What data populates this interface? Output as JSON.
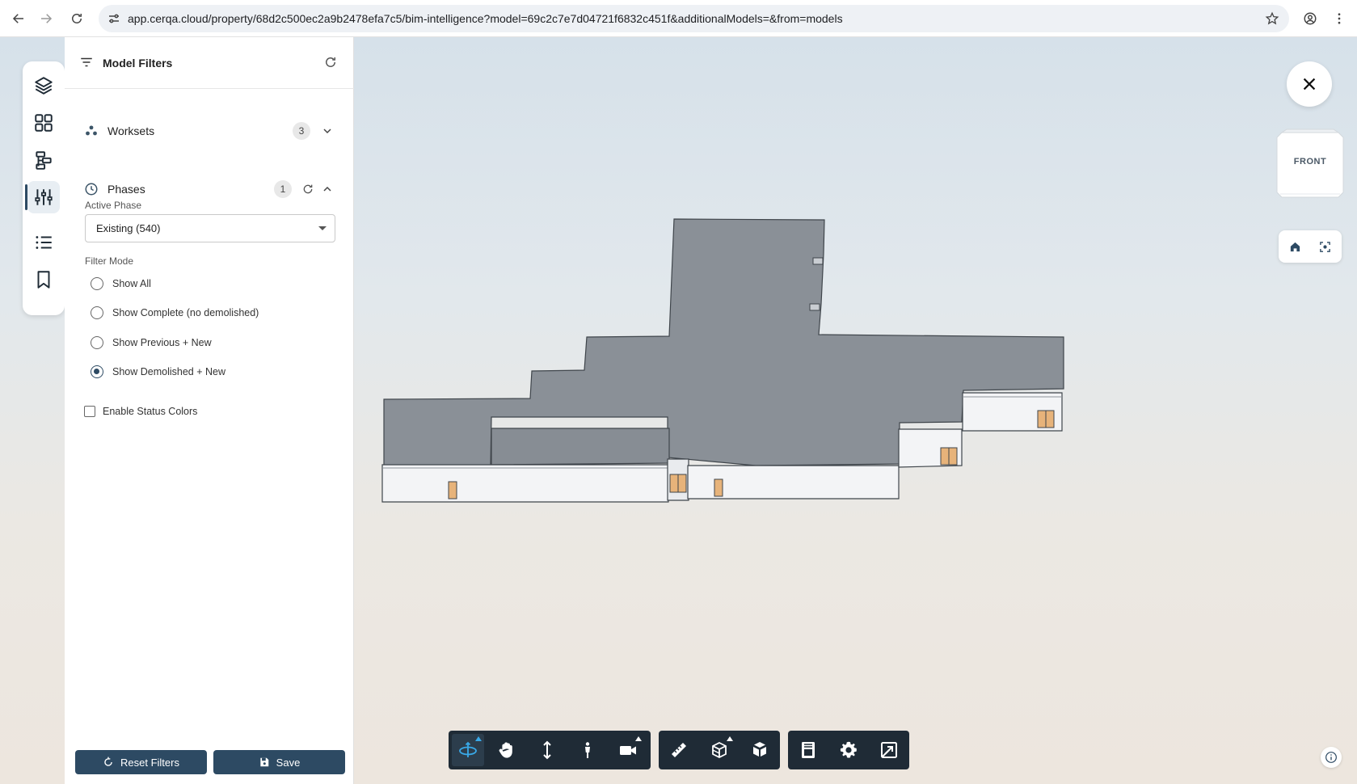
{
  "browser": {
    "url": "app.cerqa.cloud/property/68d2c500ec2a9b2478efa7c5/bim-intelligence?model=69c2c7e7d04721f6832c451f&additionalModels=&from=models"
  },
  "rail": {
    "items": [
      {
        "icon": "layers-icon"
      },
      {
        "icon": "grid-icon"
      },
      {
        "icon": "hierarchy-icon"
      },
      {
        "icon": "sliders-icon",
        "active": true
      },
      {
        "icon": "list-icon"
      },
      {
        "icon": "bookmark-icon"
      }
    ]
  },
  "panel": {
    "title": "Model Filters",
    "worksets": {
      "label": "Worksets",
      "count": "3"
    },
    "phases": {
      "label": "Phases",
      "count": "1"
    },
    "active_phase_label": "Active Phase",
    "active_phase_value": "Existing (540)",
    "filter_mode_label": "Filter Mode",
    "filter_modes": [
      {
        "label": "Show All",
        "checked": false
      },
      {
        "label": "Show Complete (no demolished)",
        "checked": false
      },
      {
        "label": "Show Previous + New",
        "checked": false
      },
      {
        "label": "Show Demolished + New",
        "checked": true
      }
    ],
    "status_colors_label": "Enable Status Colors",
    "status_colors_checked": false,
    "reset_label": "Reset Filters",
    "save_label": "Save"
  },
  "view_cube": {
    "face": "FRONT"
  },
  "toolbar": {
    "active_tool": "orbit",
    "groups": [
      [
        "orbit",
        "pan",
        "zoom",
        "first-person",
        "camera"
      ],
      [
        "measure",
        "section",
        "explode"
      ],
      [
        "model-browser",
        "settings",
        "fullscreen"
      ]
    ]
  },
  "colors": {
    "accent": "#2d4a63",
    "toolbar": "#1f2b36",
    "roof": "#8a9097",
    "door": "#e7b37a"
  }
}
